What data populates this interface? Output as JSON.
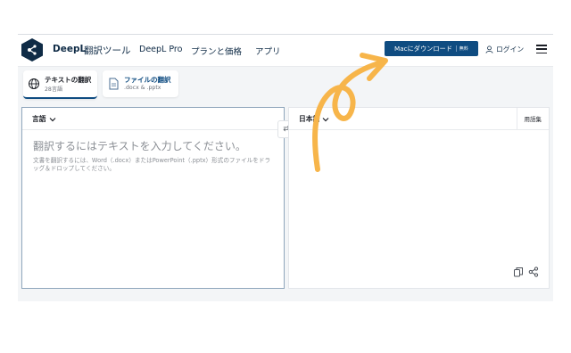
{
  "header": {
    "brand": "DeepL",
    "brand_sub": "翻訳ツール",
    "nav": [
      "DeepL Pro",
      "プランと価格",
      "アプリ"
    ],
    "download_label": "Macにダウンロード",
    "download_badge": "無料",
    "login_label": "ログイン"
  },
  "tabs": [
    {
      "title": "テキストの翻訳",
      "subtitle": "28言語",
      "icon": "globe-icon",
      "active": true
    },
    {
      "title": "ファイルの翻訳",
      "subtitle": ".docx & .pptx",
      "icon": "document-icon",
      "active": false
    }
  ],
  "source": {
    "language": "言語",
    "placeholder": "翻訳するにはテキストを入力してください。",
    "hint": "文書を翻訳するには、Word（.docx）またはPowerPoint（.pptx）形式のファイルをドラッグ＆ドロップしてください。"
  },
  "target": {
    "language": "日本語",
    "glossary_label": "用語集"
  },
  "swap_symbol": "⇄",
  "colors": {
    "accent": "#0f4c81",
    "annotation_arrow": "#f7b54a"
  }
}
